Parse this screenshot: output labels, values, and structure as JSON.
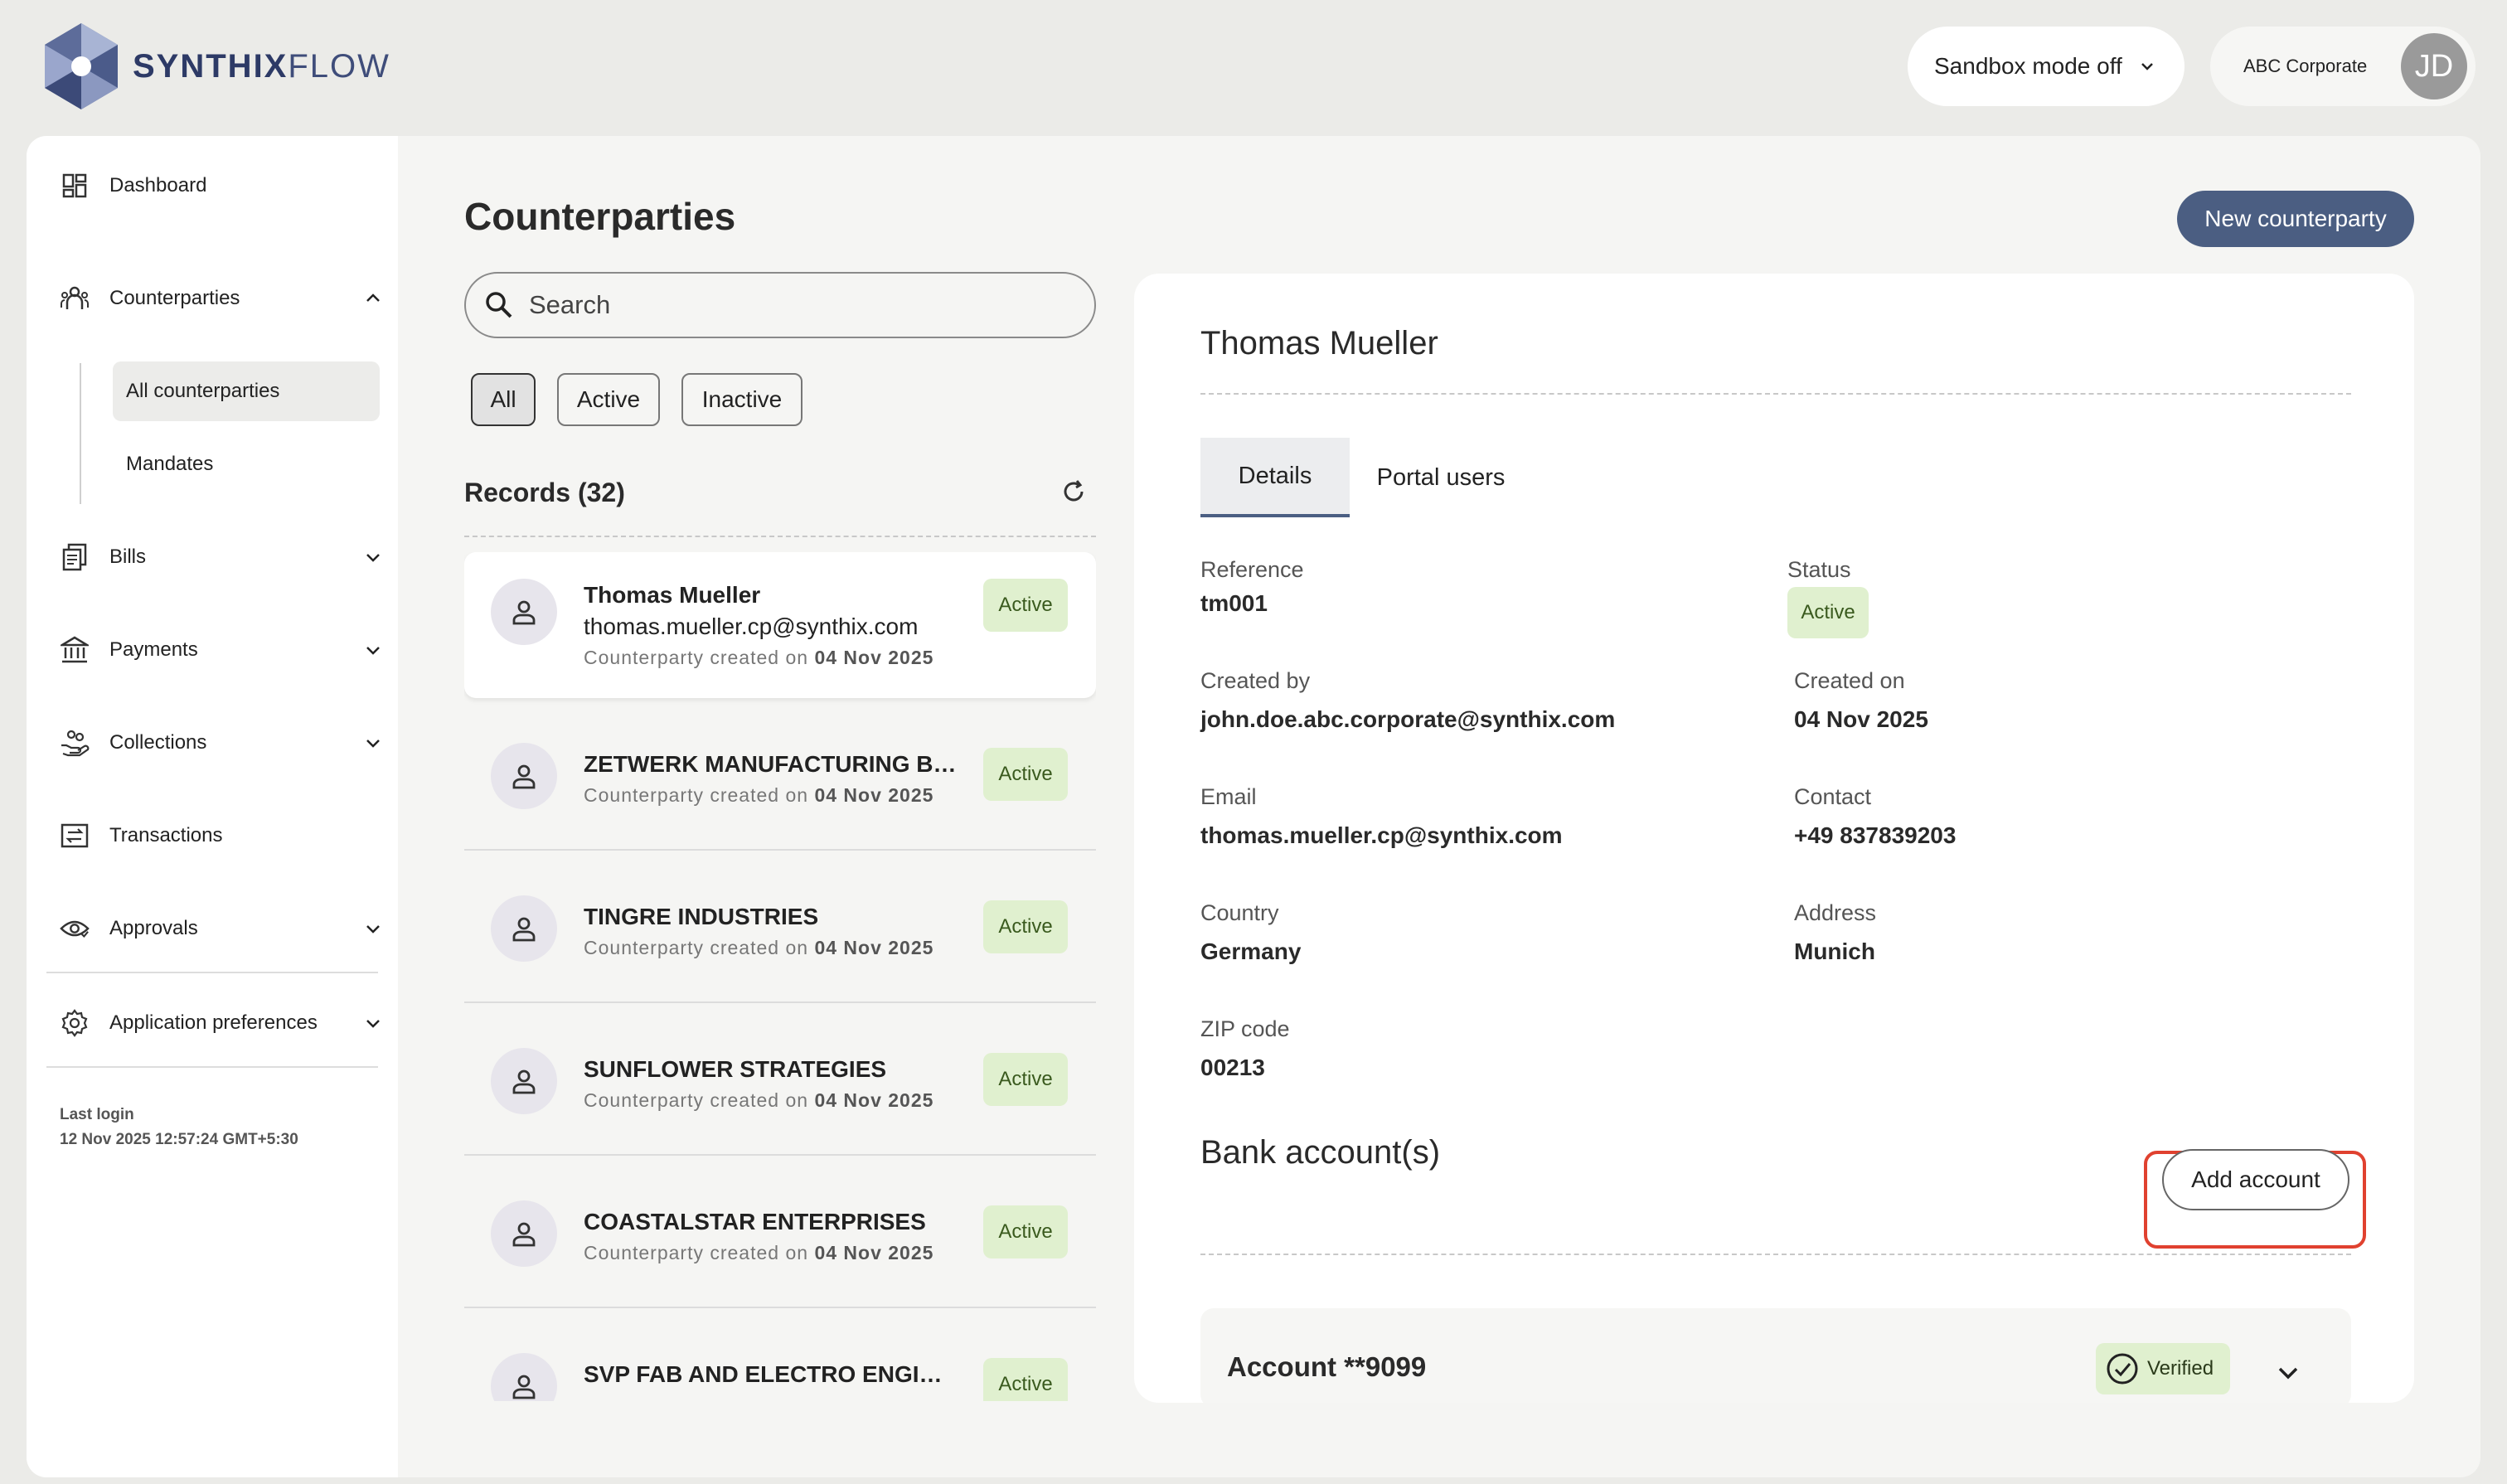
{
  "brand": {
    "name_bold": "SYNTHIX",
    "name_light": "FLOW"
  },
  "topbar": {
    "sandbox_label": "Sandbox mode off",
    "org_name": "ABC Corporate",
    "avatar_initials": "JD"
  },
  "sidebar": {
    "items": [
      {
        "label": "Dashboard",
        "icon": "dashboard-icon"
      },
      {
        "label": "Counterparties",
        "icon": "people-icon"
      },
      {
        "label": "Bills",
        "icon": "bills-icon"
      },
      {
        "label": "Payments",
        "icon": "bank-icon"
      },
      {
        "label": "Collections",
        "icon": "hand-coins-icon"
      },
      {
        "label": "Transactions",
        "icon": "transfer-icon"
      },
      {
        "label": "Approvals",
        "icon": "eye-icon"
      },
      {
        "label": "Application preferences",
        "icon": "gear-icon"
      }
    ],
    "sub_items": [
      "All counterparties",
      "Mandates"
    ],
    "last_login_label": "Last login",
    "last_login_value": "12 Nov 2025 12:57:24 GMT+5:30"
  },
  "main": {
    "title": "Counterparties",
    "new_button": "New counterparty",
    "search_placeholder": "Search",
    "filters": [
      "All",
      "Active",
      "Inactive"
    ],
    "records_label": "Records (32)"
  },
  "records": [
    {
      "name": "Thomas Mueller",
      "email": "thomas.mueller.cp@synthix.com",
      "created_prefix": "Counterparty created on ",
      "created_date": "04 Nov 2025",
      "status": "Active"
    },
    {
      "name": "ZETWERK MANUFACTURING BUSINESSES PRIVATE LIMITED",
      "created_prefix": "Counterparty created on ",
      "created_date": "04 Nov 2025",
      "status": "Active"
    },
    {
      "name": "TINGRE INDUSTRIES",
      "created_prefix": "Counterparty created on ",
      "created_date": "04 Nov 2025",
      "status": "Active"
    },
    {
      "name": "SUNFLOWER STRATEGIES",
      "created_prefix": "Counterparty created on ",
      "created_date": "04 Nov 2025",
      "status": "Active"
    },
    {
      "name": "COASTALSTAR ENTERPRISES",
      "created_prefix": "Counterparty created on ",
      "created_date": "04 Nov 2025",
      "status": "Active"
    },
    {
      "name": "SVP FAB AND ELECTRO ENGINEERING",
      "status": "Active"
    }
  ],
  "detail": {
    "name": "Thomas Mueller",
    "tabs": [
      "Details",
      "Portal users"
    ],
    "fields": {
      "reference_label": "Reference",
      "reference": "tm001",
      "status_label": "Status",
      "status": "Active",
      "created_by_label": "Created by",
      "created_by": "john.doe.abc.corporate@synthix.com",
      "created_on_label": "Created on",
      "created_on": "04 Nov 2025",
      "email_label": "Email",
      "email": "thomas.mueller.cp@synthix.com",
      "contact_label": "Contact",
      "contact": "+49 837839203",
      "country_label": "Country",
      "country": "Germany",
      "address_label": "Address",
      "address": "Munich",
      "zip_label": "ZIP code",
      "zip": "00213"
    },
    "bank_title": "Bank account(s)",
    "add_account": "Add account",
    "account": {
      "name": "Account **9099",
      "status": "Verified"
    }
  },
  "colors": {
    "accent": "#4b5e82",
    "badge_bg": "#e0f0cf",
    "highlight": "#e0412f"
  }
}
